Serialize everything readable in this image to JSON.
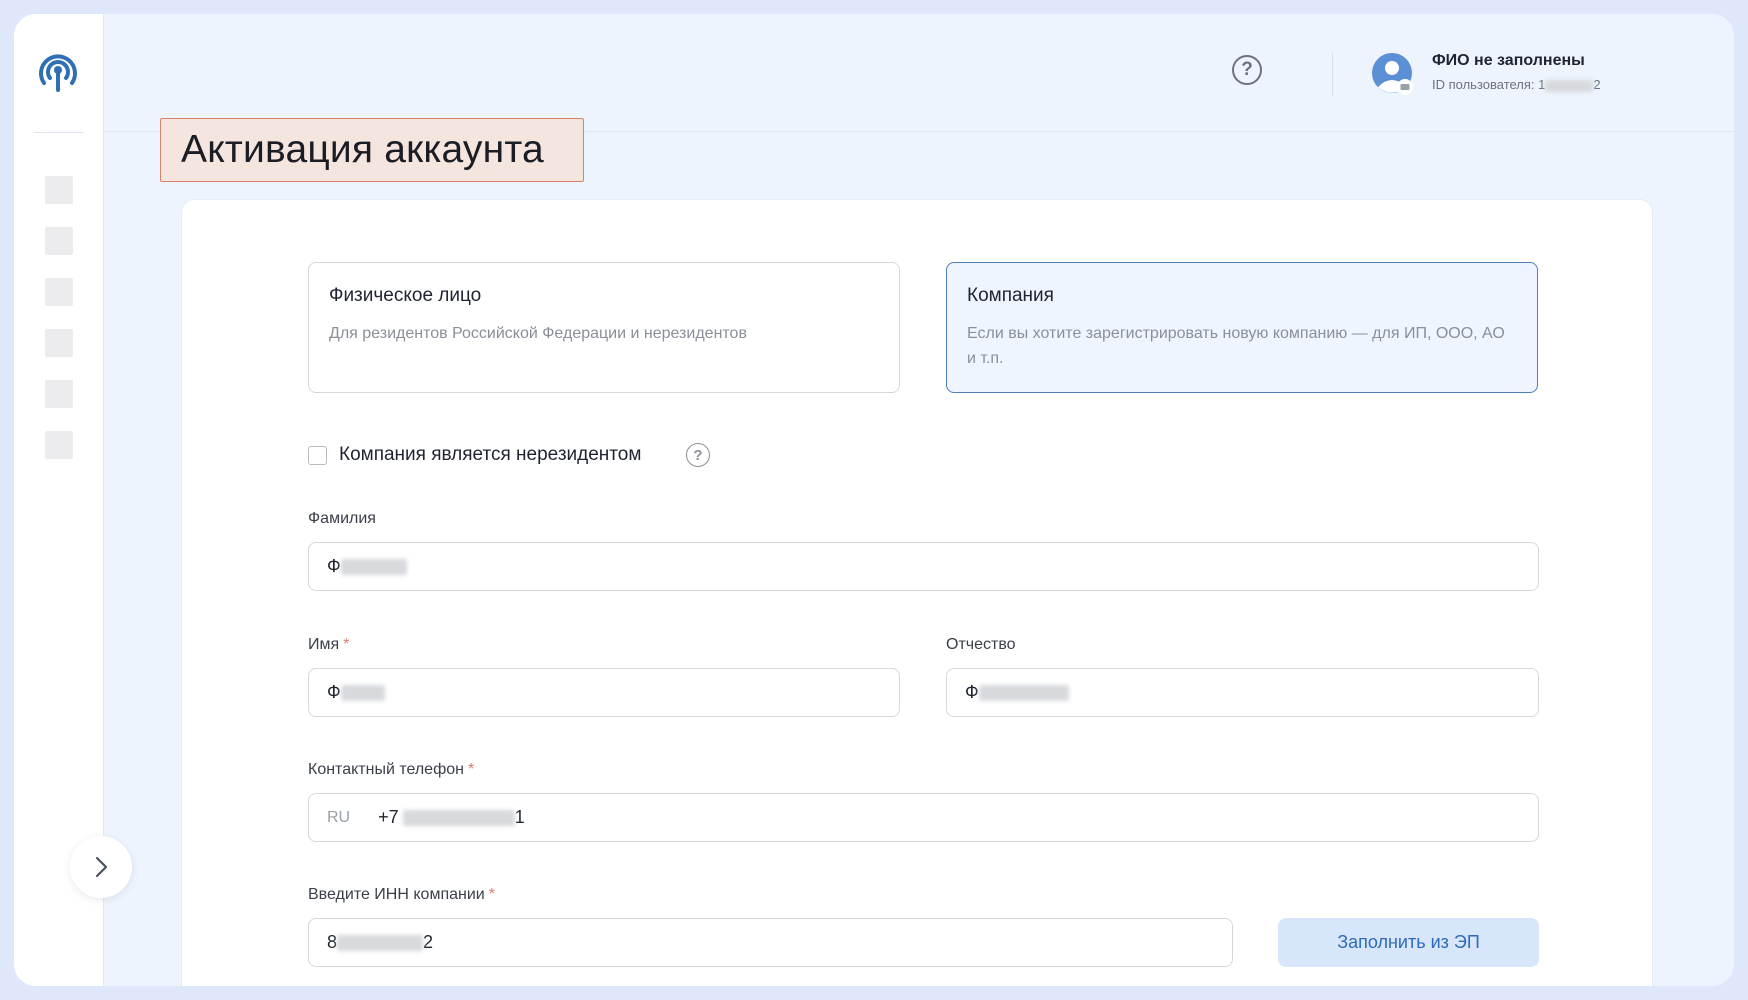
{
  "header": {
    "user_name": "ФИО не заполнены",
    "user_id_label": "ID пользователя:",
    "user_id_start": "1",
    "user_id_end": "2"
  },
  "page": {
    "title": "Активация аккаунта"
  },
  "account_type": {
    "individual": {
      "title": "Физическое лицо",
      "description": "Для резидентов Российской Федерации и нерезидентов"
    },
    "company": {
      "title": "Компания",
      "description": "Если вы хотите зарегистрировать новую компанию — для ИП, ООО, АО и т.п.",
      "selected": true
    }
  },
  "non_resident": {
    "label": "Компания является нерезидентом",
    "checked": false
  },
  "form": {
    "surname": {
      "label": "Фамилия",
      "value_start": "Ф"
    },
    "name": {
      "label": "Имя",
      "required_mark": "*",
      "value_start": "Ф"
    },
    "patronymic": {
      "label": "Отчество",
      "value_start": "Ф"
    },
    "phone": {
      "label": "Контактный телефон",
      "required_mark": "*",
      "country": "RU",
      "value_start": "+7",
      "value_end": "1"
    },
    "inn": {
      "label": "Введите ИНН компании",
      "required_mark": "*",
      "value_start": "8",
      "value_end": "2"
    },
    "fill_button": "Заполнить из ЭП"
  },
  "colors": {
    "accent": "#2e6bb8",
    "selected_border": "#4d7fb8",
    "title_highlight": "#f5e5df"
  }
}
